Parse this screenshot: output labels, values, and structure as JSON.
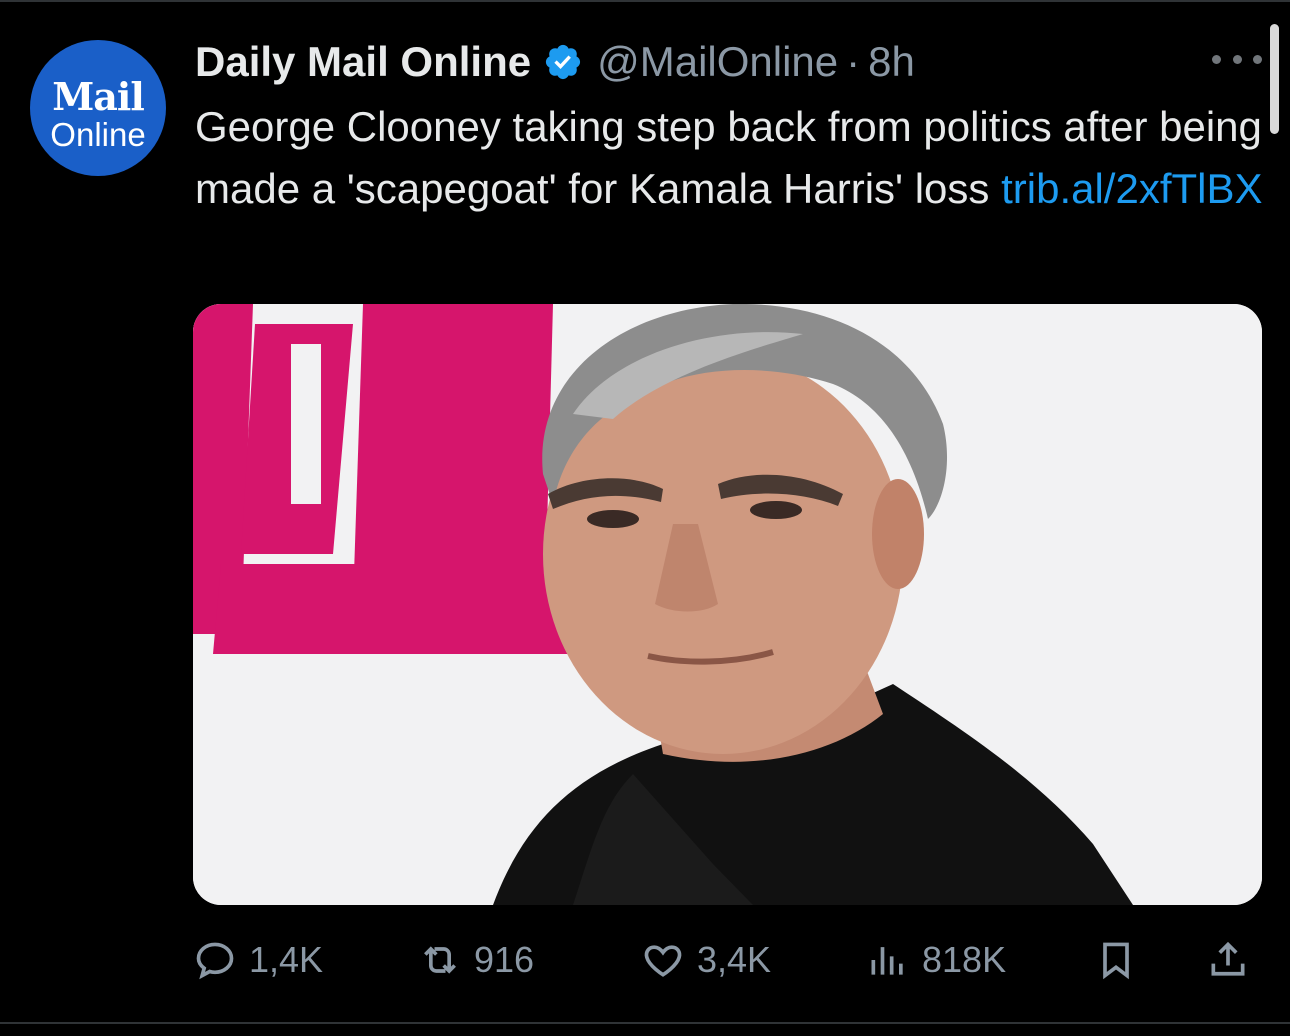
{
  "avatar": {
    "brand_mark": "Mail",
    "brand_sub": "Online",
    "bg_color": "#1a5fc8"
  },
  "header": {
    "display_name": "Daily Mail Online",
    "verified_icon": "verified-badge-icon",
    "handle": "@MailOnline",
    "separator": "·",
    "time": "8h",
    "more_icon": "more-options-icon"
  },
  "tweet": {
    "text": "George Clooney taking step back from politics after being made a 'scapegoat' for Kamala Harris' loss",
    "link": "trib.al/2xfTlBX"
  },
  "media": {
    "description": "photo-icon"
  },
  "actions": {
    "reply_count": "1,4K",
    "retweet_count": "916",
    "like_count": "3,4K",
    "views_count": "818K",
    "icons": [
      "reply-icon",
      "retweet-icon",
      "like-icon",
      "views-icon",
      "bookmark-icon",
      "share-icon"
    ]
  },
  "colors": {
    "background": "#000000",
    "text": "#e7e9ea",
    "secondary": "#8b98a5",
    "link": "#1d9bf0",
    "verified": "#1d9bf0"
  }
}
